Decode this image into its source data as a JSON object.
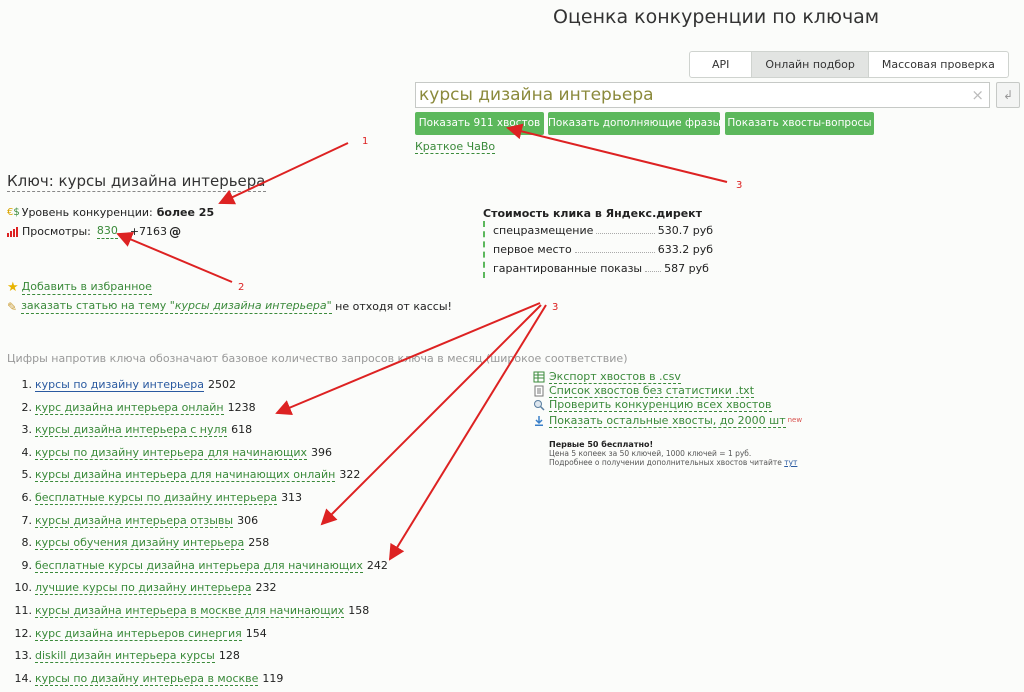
{
  "header": {
    "title": "Оценка конкуренции по ключам"
  },
  "modes": [
    "API",
    "Онлайн подбор",
    "Массовая проверка"
  ],
  "search": {
    "value": "курсы дизайна интерьера",
    "clear_glyph": "×",
    "enter_glyph": "↲"
  },
  "buttons": {
    "show_tails": "Показать 911 хвостов",
    "show_extra": "Показать дополняющие фразы",
    "show_questions": "Показать хвосты-вопросы"
  },
  "faq_link": "Краткое ЧаВо",
  "key": {
    "label": "Ключ: курсы дизайна интерьера"
  },
  "competition": {
    "label": "Уровень конкуренции:",
    "value": "более 25"
  },
  "views": {
    "label": "Просмотры:",
    "value": "830",
    "delta": "+7163"
  },
  "actions": {
    "favorite": "Добавить в избранное",
    "order_prefix": "заказать статью на тему \"",
    "order_topic": "курсы дизайна интерьера",
    "order_suffix": "\"",
    "order_tail": " не отходя от кассы!"
  },
  "price": {
    "title": "Стоимость клика в Яндекс.директ",
    "rows": [
      {
        "label": "спецразмещение",
        "value": "530.7 руб"
      },
      {
        "label": "первое место",
        "value": "633.2 руб"
      },
      {
        "label": "гарантированные показы",
        "value": "587 руб"
      }
    ]
  },
  "note": "Цифры напротив ключа обозначают базовое количество запросов ключа в месяц (широкое соответствие)",
  "tails": [
    {
      "n": "1.",
      "text": "курсы по дизайну интерьера",
      "count": "2502"
    },
    {
      "n": "2.",
      "text": "курс дизайна интерьера онлайн",
      "count": "1238"
    },
    {
      "n": "3.",
      "text": "курсы дизайна интерьера с нуля",
      "count": "618"
    },
    {
      "n": "4.",
      "text": "курсы по дизайну интерьера для начинающих",
      "count": "396"
    },
    {
      "n": "5.",
      "text": "курсы дизайна интерьера для начинающих онлайн",
      "count": "322"
    },
    {
      "n": "6.",
      "text": "бесплатные курсы по дизайну интерьера",
      "count": "313"
    },
    {
      "n": "7.",
      "text": "курсы дизайна интерьера отзывы",
      "count": "306"
    },
    {
      "n": "8.",
      "text": "курсы обучения дизайну интерьера",
      "count": "258"
    },
    {
      "n": "9.",
      "text": "бесплатные курсы дизайна интерьера для начинающих",
      "count": "242"
    },
    {
      "n": "10.",
      "text": "лучшие курсы по дизайну интерьера",
      "count": "232"
    },
    {
      "n": "11.",
      "text": "курсы дизайна интерьера в москве для начинающих",
      "count": "158"
    },
    {
      "n": "12.",
      "text": "курс дизайна интерьеров синергия",
      "count": "154"
    },
    {
      "n": "13.",
      "text": "diskill дизайн интерьера курсы",
      "count": "128"
    },
    {
      "n": "14.",
      "text": "курсы по дизайну интерьера в москве",
      "count": "119"
    }
  ],
  "side": {
    "export_csv": "Экспорт хвостов в .csv",
    "list_txt": "Список хвостов без статистики .txt",
    "check_all": "Проверить конкуренцию всех хвостов",
    "show_rest": "Показать остальные хвосты, до 2000 шт",
    "new_badge": "new",
    "fine_title": "Первые 50 бесплатно!",
    "fine_line1": "Цена 5 копеек за 50 ключей, 1000 ключей = 1 руб.",
    "fine_line2": "Подробнее о получении дополнительных хвостов читайте",
    "fine_link": "тут"
  },
  "annotations": [
    "1",
    "2",
    "3",
    "3"
  ],
  "colors": {
    "accent_green": "#5cb85c",
    "link_green": "#3a8a3a",
    "annotation_red": "#dd2222",
    "search_text": "#8b8a3c"
  }
}
